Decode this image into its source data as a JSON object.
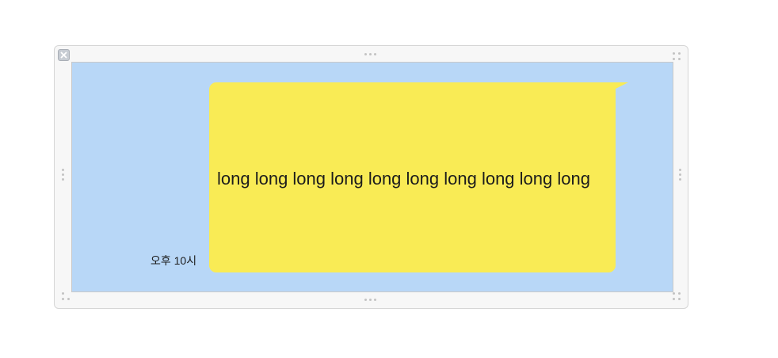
{
  "message": {
    "text": "long long long long long long long long long long",
    "timestamp": "오후 10시"
  },
  "colors": {
    "canvas_background": "#b8d7f7",
    "bubble_background": "#f9eb55",
    "window_chrome": "#f7f7f7"
  },
  "icons": {
    "close": "close-icon",
    "resize_handles": "grip-dots-icon"
  }
}
